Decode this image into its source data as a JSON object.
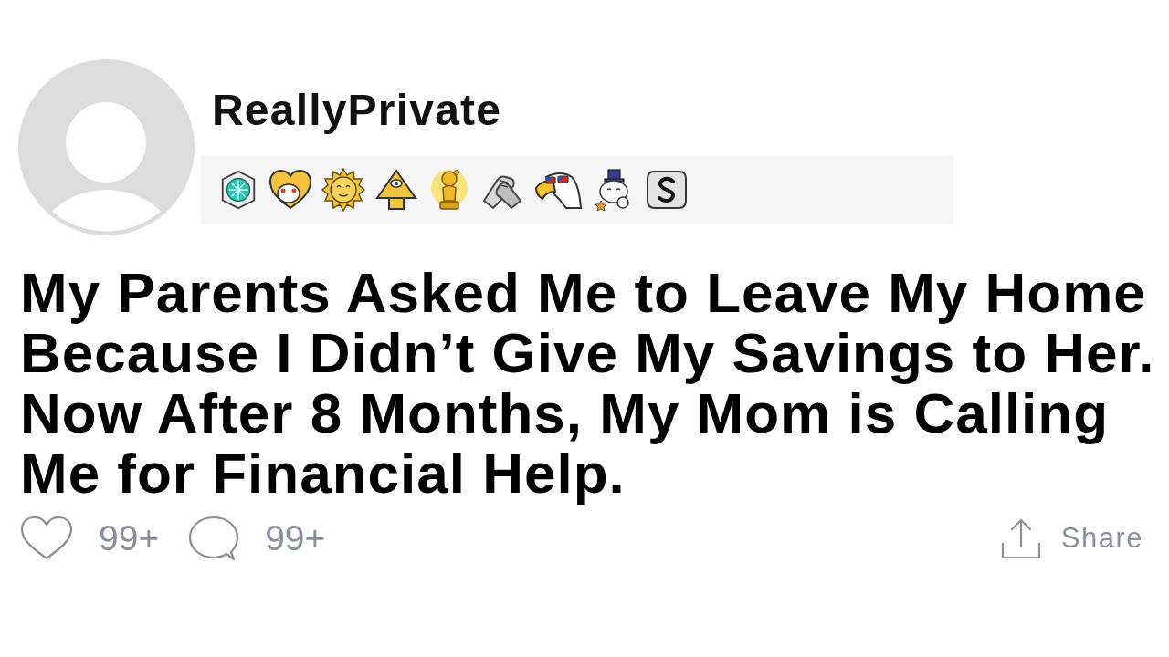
{
  "post": {
    "author": "ReallyPrivate",
    "title": "My Parents Asked Me to Leave My Home Because I Didn’t Give My Savings to Her. Now After 8 Months, My Mom is Calling Me for Financial Help."
  },
  "actions": [
    {
      "kind": "like",
      "label": "99+"
    },
    {
      "kind": "comment",
      "label": "99+"
    },
    {
      "kind": "share",
      "label": "Share"
    }
  ]
}
